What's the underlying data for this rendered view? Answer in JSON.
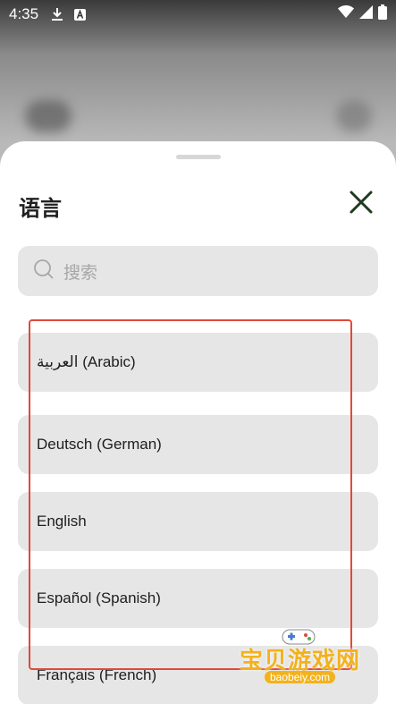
{
  "status_bar": {
    "time": "4:35",
    "icons": [
      "download-icon",
      "a-badge-icon",
      "wifi-icon",
      "signal-icon",
      "battery-icon"
    ]
  },
  "sheet": {
    "title": "语言",
    "close_icon": "close-icon",
    "search": {
      "placeholder": "搜索",
      "icon": "search-icon"
    },
    "languages": [
      "العربية (Arabic)",
      "Deutsch (German)",
      "English",
      "Español (Spanish)",
      "Français (French)"
    ]
  },
  "watermark": {
    "text": "宝贝游戏网",
    "url": "baobeiy.com"
  },
  "colors": {
    "highlight_border": "#e0493a",
    "item_bg": "#e6e6e6",
    "title": "#1f1f1f",
    "close": "#1f3a1f",
    "watermark": "#f3b21c"
  }
}
